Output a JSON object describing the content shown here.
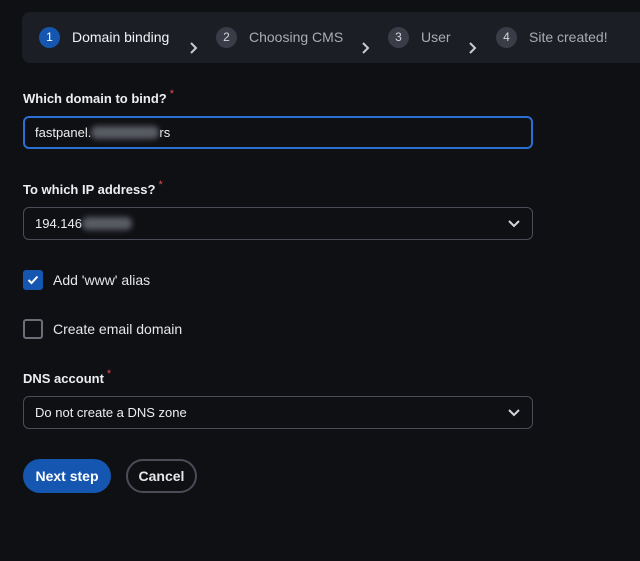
{
  "stepper": {
    "steps": [
      {
        "num": "1",
        "label": "Domain binding"
      },
      {
        "num": "2",
        "label": "Choosing CMS"
      },
      {
        "num": "3",
        "label": "User"
      },
      {
        "num": "4",
        "label": "Site created!"
      }
    ]
  },
  "form": {
    "domain": {
      "label": "Which domain to bind?",
      "required_mark": "*",
      "value_prefix": "fastpanel.",
      "value_suffix": "rs"
    },
    "ip": {
      "label": "To which IP address?",
      "required_mark": "*",
      "value_prefix": "194.146"
    },
    "www_alias": {
      "label": "Add 'www' alias",
      "checked": true
    },
    "email_domain": {
      "label": "Create email domain",
      "checked": false
    },
    "dns": {
      "label": "DNS account",
      "required_mark": "*",
      "value": "Do not create a DNS zone"
    }
  },
  "actions": {
    "next_label": "Next step",
    "cancel_label": "Cancel"
  },
  "colors": {
    "accent": "#1557b0",
    "required": "#e5484d",
    "background": "#0f1014"
  }
}
